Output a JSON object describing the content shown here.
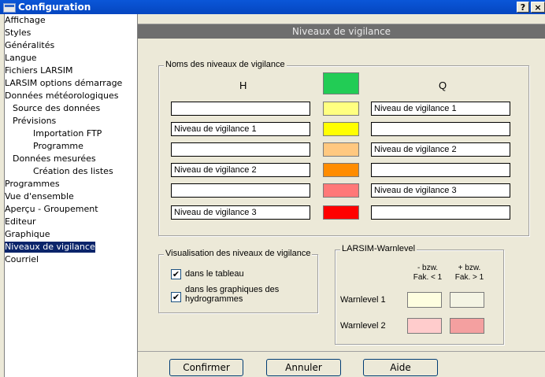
{
  "window": {
    "title": "Configuration",
    "help_label": "?",
    "close_label": "×"
  },
  "sidebar": {
    "items": [
      {
        "label": "Affichage",
        "level": 0
      },
      {
        "label": "Styles",
        "level": 0
      },
      {
        "label": "Généralités",
        "level": 0
      },
      {
        "label": "Langue",
        "level": 0
      },
      {
        "label": "Fichiers LARSIM",
        "level": 0
      },
      {
        "label": "LARSIM options démarrage",
        "level": 0
      },
      {
        "label": "Données météorologiques",
        "level": 0
      },
      {
        "label": "Source des données",
        "level": 1
      },
      {
        "label": "Prévisions",
        "level": 1
      },
      {
        "label": "Importation FTP",
        "level": 2
      },
      {
        "label": "Programme",
        "level": 2
      },
      {
        "label": "Données mesurées",
        "level": 1
      },
      {
        "label": "Création des listes",
        "level": 2
      },
      {
        "label": "Programmes",
        "level": 0
      },
      {
        "label": "Vue d'ensemble",
        "level": 0
      },
      {
        "label": "Aperçu - Groupement",
        "level": 0
      },
      {
        "label": "Editeur",
        "level": 0
      },
      {
        "label": "Graphique",
        "level": 0
      },
      {
        "label": "Niveaux de vigilance",
        "level": 0,
        "selected": true
      },
      {
        "label": "Courriel",
        "level": 0
      }
    ]
  },
  "panel": {
    "title": "Niveaux de vigilance",
    "names_group": {
      "legend": "Noms des niveaux de vigilance",
      "h_header": "H",
      "q_header": "Q",
      "header_color": "#22cc55",
      "rows": [
        {
          "h": "",
          "color": "#ffff80",
          "q": "Niveau de vigilance 1"
        },
        {
          "h": "Niveau de vigilance 1",
          "color": "#ffff00",
          "q": ""
        },
        {
          "h": "",
          "color": "#ffc880",
          "q": "Niveau de vigilance 2"
        },
        {
          "h": "Niveau de vigilance 2",
          "color": "#ff8c00",
          "q": ""
        },
        {
          "h": "",
          "color": "#ff7878",
          "q": "Niveau de vigilance 3"
        },
        {
          "h": "Niveau de vigilance 3",
          "color": "#ff0000",
          "q": ""
        }
      ]
    },
    "visual_group": {
      "legend": "Visualisation des niveaux de vigilance",
      "opt_table": {
        "label": "dans le tableau",
        "checked": true
      },
      "opt_graph": {
        "label_line1": "dans les graphiques des",
        "label_line2": "hydrogrammes",
        "checked": true
      }
    },
    "larsim_group": {
      "legend": "LARSIM-Warnlevel",
      "col1_line1": "- bzw.",
      "col1_line2": "Fak. < 1",
      "col2_line1": "+ bzw.",
      "col2_line2": "Fak. > 1",
      "rows": [
        {
          "label": "Warnlevel 1",
          "c1": "#fefee0",
          "c2": "#f4f4e4"
        },
        {
          "label": "Warnlevel 2",
          "c1": "#ffcccc",
          "c2": "#f4a0a0"
        }
      ]
    },
    "buttons": {
      "confirm": "Confirmer",
      "cancel": "Annuler",
      "help": "Aide"
    }
  }
}
